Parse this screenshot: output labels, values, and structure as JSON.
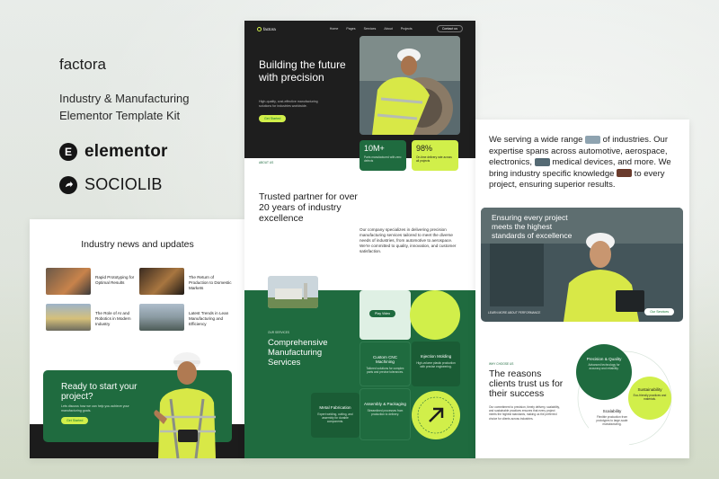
{
  "brand": {
    "name": "factora",
    "tagline": "Industry & Manufacturing Elementor Template Kit",
    "partners": [
      {
        "name": "elementor",
        "icon": "elementor-logo-icon"
      },
      {
        "name": "SOCIOLIB",
        "icon": "sociolib-arrow-icon"
      }
    ]
  },
  "left_panel": {
    "title": "Industry news and updates",
    "news": [
      {
        "title": "Rapid Prototyping for Optimal Results"
      },
      {
        "title": "The Return of Production to Domestic Markets"
      },
      {
        "title": "The Role of AI and Robotics in Modern Industry"
      },
      {
        "title": "Latest Trends in Lean Manufacturing and Efficiency"
      }
    ],
    "cta": {
      "title": "Ready to start your project?",
      "desc": "Lets discuss how we can help you achieve your manufacturing goals.",
      "button": "Get Started"
    }
  },
  "center_panel": {
    "nav": {
      "logo": "factora",
      "links": [
        "Home",
        "Pages",
        "Services",
        "About",
        "Projects"
      ],
      "button": "Contact us"
    },
    "hero": {
      "title": "Building the future with precision",
      "subtitle": "High-quality, cost-effective manufacturing solutions for industries worldwide.",
      "button": "Get Started"
    },
    "stats": [
      {
        "value": "10M+",
        "desc": "Parts manufactured with zero defects"
      },
      {
        "value": "98%",
        "desc": "On-time delivery rate across all projects"
      }
    ],
    "about": {
      "tag": "ABOUT US",
      "title": "Trusted partner for over 20 years of industry excellence",
      "body": "Our company specializes in delivering precision manufacturing services tailored to meet the diverse needs of industries, from automotive to aerospace. We're committed to quality, innovation, and customer satisfaction."
    },
    "services": {
      "tag": "OUR SERVICES",
      "title": "Comprehensive Manufacturing Services",
      "play_button": "Play Video",
      "cards": [
        {
          "title": "Custom CNC Machining",
          "desc": "Tailored solutions for complex parts and precise tolerances."
        },
        {
          "title": "Injection Molding",
          "desc": "High-volume plastic production with precise engineering."
        },
        {
          "title": "Metal Fabrication",
          "desc": "Expert welding, cutting, and assembly for durable components."
        },
        {
          "title": "Assembly & Packaging",
          "desc": "Streamlined processes from production to delivery."
        }
      ],
      "badge_text": "DISCOVER MORE · DISCOVER MORE ·"
    }
  },
  "right_panel": {
    "lead_parts": [
      "We serving a wide range",
      "of industries. Our expertise spans across automotive, aerospace, electronics,",
      "medical devices, and more. We bring industry specific knowledge",
      "to every project, ensuring superior results."
    ],
    "photo": {
      "title": "Ensuring every project meets the highest standards of excellence",
      "caption": "LEARN MORE ABOUT PERFORMANCE",
      "button": "Our Services"
    },
    "why": {
      "tag": "WHY CHOOSE US",
      "title": "The reasons clients trust us for their success",
      "body": "Our commitment to precision, timely delivery, scalability, and sustainable practices ensures that every project meets the highest standards, making us the preferred choice for clients across industries."
    },
    "values": [
      {
        "title": "Precision & Quality",
        "desc": "Advanced technology for accuracy and reliability."
      },
      {
        "title": "Sustainability",
        "desc": "Eco-friendly practices and materials."
      },
      {
        "title": "Scalability",
        "desc": "Flexible production from prototypes to large-scale manufacturing."
      }
    ]
  },
  "colors": {
    "brand_green": "#1f6b3f",
    "accent_lime": "#d1ef4a",
    "dark": "#1e1e1e"
  }
}
